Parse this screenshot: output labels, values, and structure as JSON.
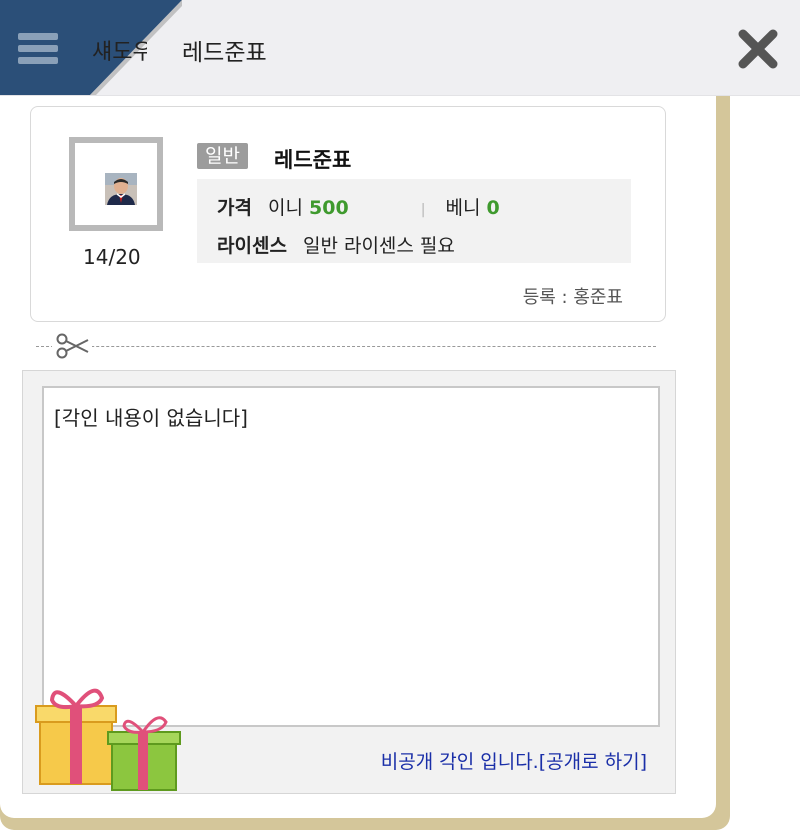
{
  "header": {
    "tab_label": "섀도우",
    "title": "레드준표"
  },
  "item": {
    "badge": "일반",
    "name": "레드준표",
    "count": "14/20",
    "price_label": "가격",
    "ini_label": "이니",
    "ini_value": "500",
    "beni_label": "베니",
    "beni_value": "0",
    "license_label": "라이센스",
    "license_value": "일반 라이센스 필요",
    "registrant": "등록 : 홍준표"
  },
  "engraving": {
    "content": "[각인 내용이 없습니다]",
    "private_text": "비공개 각인 입니다.",
    "make_public": "[공개로 하기]"
  },
  "colors": {
    "header_bg": "#efeff2",
    "menu_tab": "#2b4f78",
    "frame": "#d4c69a",
    "value_green": "#3f9a2e",
    "link_blue": "#1a2fa8"
  }
}
